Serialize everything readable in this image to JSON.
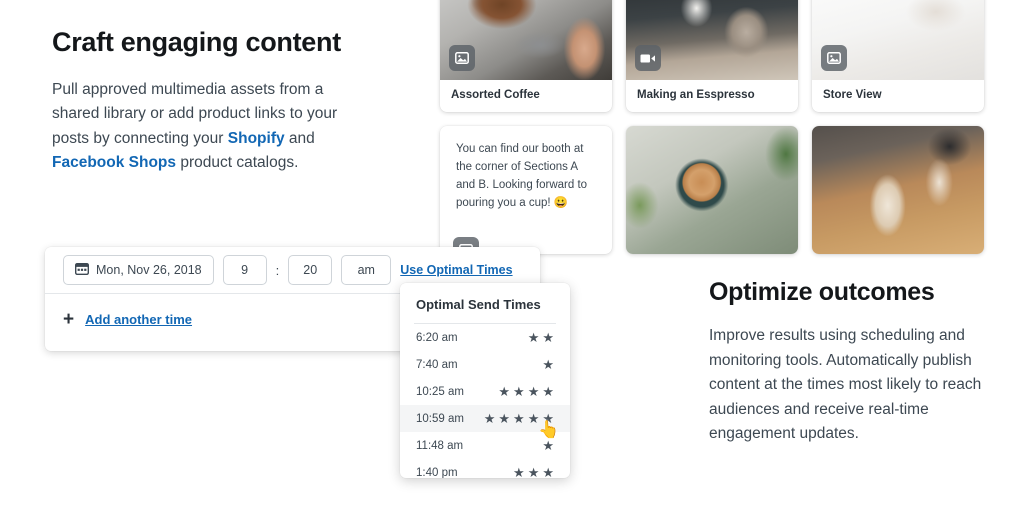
{
  "left_feature": {
    "title": "Craft engaging content",
    "body_prefix": "Pull approved multimedia assets from a shared library or add product links to your posts by connecting your ",
    "link1": "Shopify",
    "body_mid": " and ",
    "link2": "Facebook Shops",
    "body_suffix": " product catalogs."
  },
  "right_feature": {
    "title": "Optimize outcomes",
    "body": "Improve results using scheduling and monitoring tools. Automatically publish content at the times most likely to reach audiences and receive real-time engagement updates."
  },
  "media": {
    "cards": [
      {
        "caption": "Assorted Coffee",
        "badge": "image-icon"
      },
      {
        "caption": "Making an Esspresso",
        "badge": "video-icon"
      },
      {
        "caption": "Store View",
        "badge": "image-icon"
      }
    ],
    "text_card": {
      "text": "You can find our booth at the corner of Sections A and B. Looking forward to pouring you a cup! 😀",
      "badge": "image-icon"
    }
  },
  "scheduler": {
    "date_value": "Mon, Nov 26, 2018",
    "hour_value": "9",
    "colon": ":",
    "minute_value": "20",
    "meridiem_value": "am",
    "optimal_link": "Use Optimal Times",
    "calendar_icon": "calendar-icon",
    "add_plus": "+",
    "add_label": "Add another time"
  },
  "dropdown": {
    "title": "Optimal Send Times",
    "rows": [
      {
        "time": "6:20 am",
        "stars": 2,
        "hovered": false
      },
      {
        "time": "7:40 am",
        "stars": 1,
        "hovered": false
      },
      {
        "time": "10:25 am",
        "stars": 4,
        "hovered": false
      },
      {
        "time": "10:59 am",
        "stars": 5,
        "hovered": true
      },
      {
        "time": "11:48 am",
        "stars": 1,
        "hovered": false
      },
      {
        "time": "1:40 pm",
        "stars": 3,
        "hovered": false
      }
    ],
    "star_glyph": "★",
    "star_color": "#4a545e",
    "cursor": "pointer-hand-cursor"
  },
  "colors": {
    "link": "#1267b4",
    "heading": "#14171a",
    "body": "#3d4852",
    "background": "#ffffff"
  }
}
